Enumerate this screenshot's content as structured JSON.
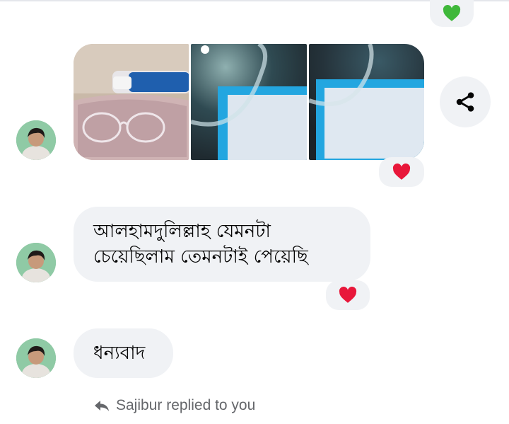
{
  "colors": {
    "bubble_bg": "#f0f2f5",
    "heart_red": "#e8173a",
    "heart_green": "#3fb83a",
    "secondary_text": "#65676b"
  },
  "messages": [
    {
      "type": "photos",
      "reaction": "red-heart-icon"
    },
    {
      "type": "text",
      "lines": [
        "আলহামদুলিল্লাহ যেমনটা",
        "চেয়েছিলাম তেমনটাই পেয়েছি"
      ],
      "reaction": "red-heart-icon"
    },
    {
      "type": "text",
      "lines": [
        "ধন্যবাদ"
      ]
    }
  ],
  "reply_notice": {
    "text": "Sajibur replied to you",
    "icon": "reply-arrow-icon"
  },
  "share": {
    "icon": "share-icon"
  }
}
